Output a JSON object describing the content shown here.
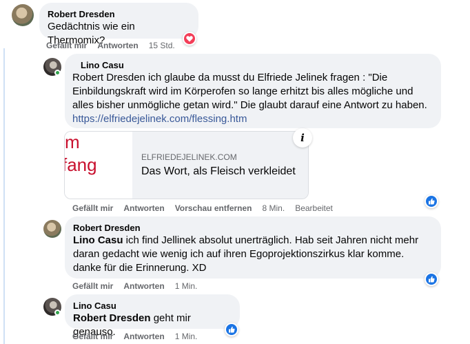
{
  "comments": [
    {
      "author": "Robert Dresden",
      "text": "Gedächtnis wie ein Thermomix?",
      "actions": {
        "like": "Gefällt mir",
        "reply": "Antworten",
        "time": "15 Std."
      },
      "reaction": "love-reaction-icon"
    },
    {
      "author": "Lino Casu",
      "mention": "",
      "text_lines": [
        "Robert Dresden ich glaube da musst du Elfriede Jelinek fragen : \"Die",
        "Einbildungskraft wird im Körperofen so lange erhitzt bis alles mögliche und",
        "alles bisher unmögliche getan wird.\" Die glaubt darauf eine Antwort zu haben."
      ],
      "link": "https://elfriedejelinek.com/flessing.htm",
      "preview": {
        "thumb_line1": "m",
        "thumb_line2": "fang",
        "domain": "ELFRIEDEJELINEK.COM",
        "title": "Das Wort, als Fleisch verkleidet",
        "info": "i"
      },
      "actions": {
        "like": "Gefällt mir",
        "reply": "Antworten",
        "remove_preview": "Vorschau entfernen",
        "time": "8 Min.",
        "edited": "Bearbeitet"
      },
      "reaction": "like-reaction-icon"
    },
    {
      "author": "Robert Dresden",
      "mention": "Lino Casu",
      "text_line1": " ich find Jellinek absolut unerträglich. Hab seit Jahren nicht mehr",
      "text_line2": "daran gedacht wie wenig ich auf ihren Egoprojektionszirkus klar komme.",
      "text_line3": "danke für die Erinnerung. XD",
      "actions": {
        "like": "Gefällt mir",
        "reply": "Antworten",
        "time": "1 Min."
      },
      "reaction": "like-reaction-icon"
    },
    {
      "author": "Lino Casu",
      "mention": "Robert Dresden",
      "text": " geht mir genauso.",
      "actions": {
        "like": "Gefällt mir",
        "reply": "Antworten",
        "time": "1 Min."
      },
      "reaction": "like-reaction-icon"
    }
  ],
  "colors": {
    "like_blue": "#1b74e4",
    "love_red": "#f33e58",
    "link_blue": "#385898",
    "bubble_gray": "#f0f2f5",
    "meta_gray": "#65676b"
  }
}
